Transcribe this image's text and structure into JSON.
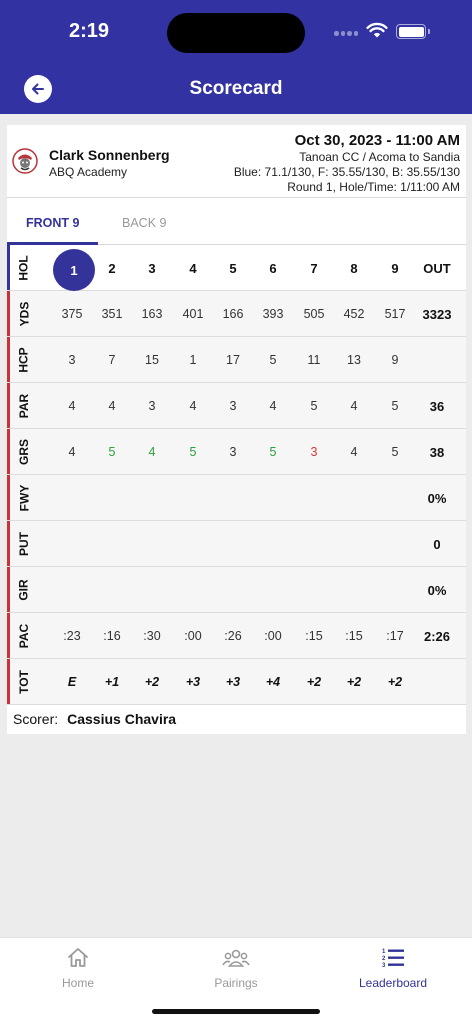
{
  "status": {
    "time": "2:19"
  },
  "header": {
    "title": "Scorecard"
  },
  "player": {
    "name": "Clark Sonnenberg",
    "team": "ABQ Academy",
    "date": "Oct 30, 2023 - 11:00 AM",
    "course": "Tanoan CC / Acoma to Sandia",
    "tees": "Blue: 71.1/130, F: 35.55/130, B: 35.55/130",
    "round": "Round 1, Hole/Time: 1/11:00 AM"
  },
  "tabs": {
    "front": "FRONT 9",
    "back": "BACK 9"
  },
  "scorecard": {
    "holes": {
      "label": "HOL",
      "values": [
        "1",
        "2",
        "3",
        "4",
        "5",
        "6",
        "7",
        "8",
        "9"
      ],
      "out": "OUT"
    },
    "yds": {
      "label": "YDS",
      "values": [
        "375",
        "351",
        "163",
        "401",
        "166",
        "393",
        "505",
        "452",
        "517"
      ],
      "out": "3323"
    },
    "hcp": {
      "label": "HCP",
      "values": [
        "3",
        "7",
        "15",
        "1",
        "17",
        "5",
        "11",
        "13",
        "9"
      ],
      "out": ""
    },
    "par": {
      "label": "PAR",
      "values": [
        "4",
        "4",
        "3",
        "4",
        "3",
        "4",
        "5",
        "4",
        "5"
      ],
      "out": "36"
    },
    "grs": {
      "label": "GRS",
      "values": [
        "4",
        "5",
        "4",
        "5",
        "3",
        "5",
        "3",
        "4",
        "5"
      ],
      "colors": [
        "",
        "green",
        "green",
        "green",
        "",
        "green",
        "red",
        "",
        ""
      ],
      "out": "38"
    },
    "fwy": {
      "label": "FWY",
      "values": [
        "",
        "",
        "",
        "",
        "",
        "",
        "",
        "",
        ""
      ],
      "out": "0%"
    },
    "put": {
      "label": "PUT",
      "values": [
        "",
        "",
        "",
        "",
        "",
        "",
        "",
        "",
        ""
      ],
      "out": "0"
    },
    "gir": {
      "label": "GIR",
      "values": [
        "",
        "",
        "",
        "",
        "",
        "",
        "",
        "",
        ""
      ],
      "out": "0%"
    },
    "pac": {
      "label": "PAC",
      "values": [
        ":23",
        ":16",
        ":30",
        ":00",
        ":26",
        ":00",
        ":15",
        ":15",
        ":17"
      ],
      "out": "2:26"
    },
    "tot": {
      "label": "TOT",
      "values": [
        "E",
        "+1",
        "+2",
        "+3",
        "+3",
        "+4",
        "+2",
        "+2",
        "+2"
      ],
      "out": ""
    }
  },
  "scorer": {
    "label": "Scorer:",
    "name": "Cassius Chavira"
  },
  "nav": {
    "home": "Home",
    "pairings": "Pairings",
    "leaderboard": "Leaderboard"
  },
  "colors": {
    "primary": "#3332a3",
    "accent_bar": "#c8333b",
    "birdie": "#2aa13a",
    "over": "#d43a3a"
  }
}
